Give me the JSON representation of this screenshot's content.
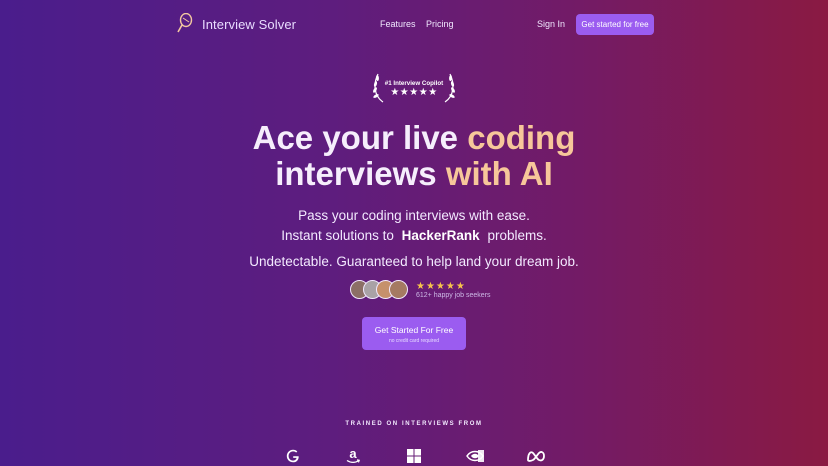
{
  "nav": {
    "brand": "Interview Solver",
    "links": [
      "Features",
      "Pricing"
    ],
    "signin": "Sign In",
    "cta": "Get started for free"
  },
  "badge": {
    "title": "#1 Interview Copilot",
    "stars": "★★★★★"
  },
  "hero": {
    "line1_plain": "Ace your live ",
    "line1_accent": "coding",
    "line2_plain": "interviews ",
    "line2_accent": "with AI"
  },
  "sub": {
    "line1": "Pass your coding interviews with ease.",
    "line2_prefix": "Instant solutions to",
    "line2_brand": "HackerRank",
    "line2_suffix": "problems."
  },
  "tagline": "Undetectable. Guaranteed to help land your dream job.",
  "social": {
    "stars": "★★★★★",
    "count_text": "612+ happy job seekers",
    "avatar_count": 4
  },
  "cta": {
    "label": "Get Started For Free",
    "sub": "no credit card required"
  },
  "trained": {
    "label": "TRAINED ON INTERVIEWS FROM",
    "companies": [
      "google-icon",
      "amazon-icon",
      "microsoft-icon",
      "nvidia-icon",
      "meta-icon"
    ]
  },
  "colors": {
    "accent": "#9b5cf0",
    "highlight": "#f7c79a",
    "star": "#f7c44a"
  }
}
